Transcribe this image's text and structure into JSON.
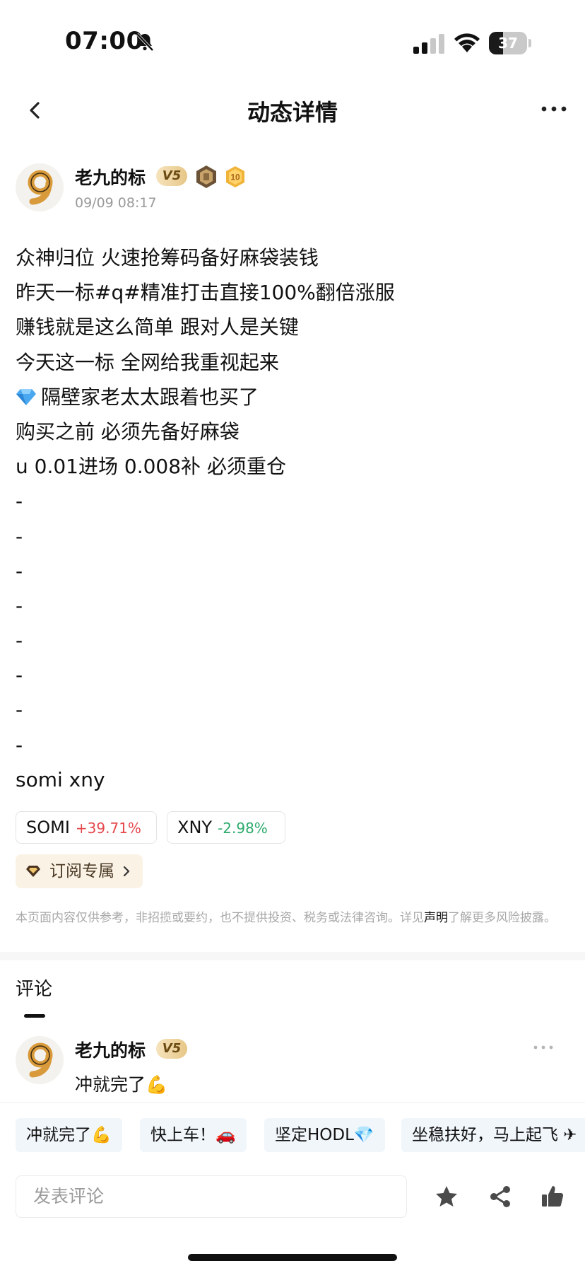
{
  "status_bar": {
    "time": "07:00",
    "battery": "37",
    "battery_level": 0.37
  },
  "nav": {
    "title": "动态详情"
  },
  "post": {
    "author": "老九的标",
    "vip_level": "V5",
    "medal_level": "10",
    "time": "09/09 08:17",
    "lines": [
      "众神归位 火速抢筹码备好麻袋装钱",
      "昨天一标#q#精准打击直接100%翻倍涨服",
      "赚钱就是这么简单 跟对人是关键",
      "今天这一标 全网给我重视起来",
      "隔壁家老太太跟着也买了",
      "购买之前 必须先备好麻袋",
      "u 0.01进场 0.008补 必须重仓",
      "-",
      "-",
      "-",
      "-",
      "-",
      "-",
      "-",
      "-",
      "somi xny"
    ]
  },
  "coins": [
    {
      "symbol": "SOMI",
      "change": "+39.71%",
      "direction": "up"
    },
    {
      "symbol": "XNY",
      "change": "-2.98%",
      "direction": "down"
    }
  ],
  "subscribe_label": "订阅专属",
  "disclaimer": {
    "before": "本页面内容仅供参考，非招揽或要约，也不提供投资、税务或法律咨询。详见",
    "link": "声明",
    "after": "了解更多风险披露。"
  },
  "comments": {
    "title": "评论",
    "items": [
      {
        "author": "老九的标",
        "vip_level": "V5",
        "text": "冲就完了💪"
      }
    ]
  },
  "quick_replies": [
    "冲就完了💪",
    "快上车！🚗",
    "坚定HODL💎",
    "坐稳扶好，马上起飞 ✈"
  ],
  "input": {
    "placeholder": "发表评论"
  },
  "colors": {
    "up": "#e5484d",
    "down": "#2eab6e",
    "vip_gold": "#e7c787",
    "accent": "#111111"
  }
}
